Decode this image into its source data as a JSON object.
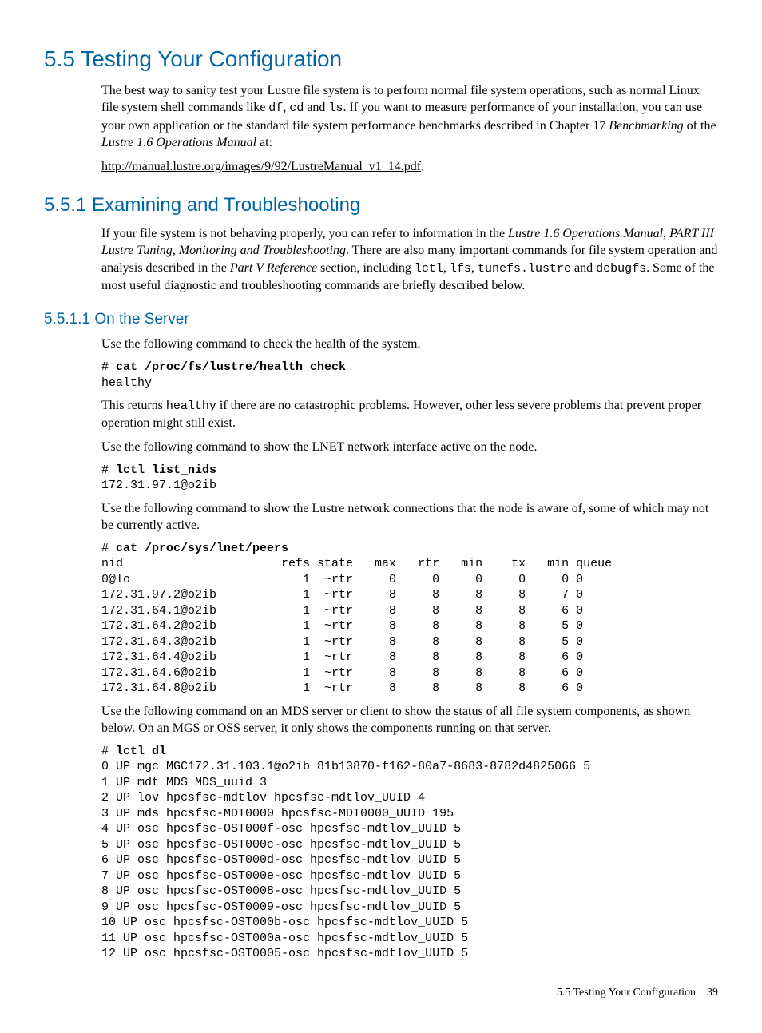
{
  "h1": "5.5 Testing Your Configuration",
  "p1a": "The best way to sanity test your Lustre file system is to perform normal file system operations, such as normal Linux file system shell commands like ",
  "p1b": "df",
  "p1c": ", ",
  "p1d": "cd",
  "p1e": " and ",
  "p1f": "ls",
  "p1g": ". If you want to measure performance of your installation, you can use your own application or the standard file system performance benchmarks described in Chapter 17 ",
  "p1h": "Benchmarking",
  "p1i": " of the ",
  "p1j": "Lustre 1.6 Operations Manual",
  "p1k": " at:",
  "link": "http://manual.lustre.org/images/9/92/LustreManual_v1_14.pdf",
  "p2end": ".",
  "h2": "5.5.1 Examining and Troubleshooting",
  "p3a": "If your file system is not behaving properly, you can refer to information in the ",
  "p3b": "Lustre 1.6 Operations Manual",
  "p3c": ", ",
  "p3d": "PART III Lustre Tuning, Monitoring and Troubleshooting",
  "p3e": ". There are also many important commands for file system operation and analysis described in the ",
  "p3f": "Part V Reference",
  "p3g": " section, including ",
  "p3h": "lctl",
  "p3i": ", ",
  "p3j": "lfs",
  "p3k": ", ",
  "p3l": "tunefs.lustre",
  "p3m": " and ",
  "p3n": "debugfs",
  "p3o": ". Some of the most useful diagnostic and troubleshooting commands are briefly described below.",
  "h3": "5.5.1.1 On the Server",
  "p4": "Use the following command to check the health of the system.",
  "code1_prompt": "# ",
  "code1_cmd": "cat /proc/fs/lustre/health_check",
  "code1_out": "healthy",
  "p5a": "This returns ",
  "p5b": "healthy",
  "p5c": " if there are no catastrophic problems. However, other less severe problems that prevent proper operation might still exist.",
  "p6": "Use the following command to show the LNET network interface active on the node.",
  "code2_prompt": "# ",
  "code2_cmd": "lctl list_nids",
  "code2_out": "172.31.97.1@o2ib",
  "p7": "Use the following command to show the Lustre network connections that the node is aware of, some of which may not be currently active.",
  "code3_prompt": "# ",
  "code3_cmd": "cat /proc/sys/lnet/peers",
  "code3_out": "nid                      refs state   max   rtr   min    tx   min queue\n0@lo                        1  ~rtr     0     0     0     0     0 0\n172.31.97.2@o2ib            1  ~rtr     8     8     8     8     7 0\n172.31.64.1@o2ib            1  ~rtr     8     8     8     8     6 0\n172.31.64.2@o2ib            1  ~rtr     8     8     8     8     5 0\n172.31.64.3@o2ib            1  ~rtr     8     8     8     8     5 0\n172.31.64.4@o2ib            1  ~rtr     8     8     8     8     6 0\n172.31.64.6@o2ib            1  ~rtr     8     8     8     8     6 0\n172.31.64.8@o2ib            1  ~rtr     8     8     8     8     6 0",
  "p8": "Use the following command on an MDS server or client to show the status of all file system components, as shown below. On an MGS or OSS server, it only shows the components running on that server.",
  "code4_prompt": "# ",
  "code4_cmd": "lctl dl",
  "code4_out": "0 UP mgc MGC172.31.103.1@o2ib 81b13870-f162-80a7-8683-8782d4825066 5\n1 UP mdt MDS MDS_uuid 3\n2 UP lov hpcsfsc-mdtlov hpcsfsc-mdtlov_UUID 4\n3 UP mds hpcsfsc-MDT0000 hpcsfsc-MDT0000_UUID 195\n4 UP osc hpcsfsc-OST000f-osc hpcsfsc-mdtlov_UUID 5\n5 UP osc hpcsfsc-OST000c-osc hpcsfsc-mdtlov_UUID 5\n6 UP osc hpcsfsc-OST000d-osc hpcsfsc-mdtlov_UUID 5\n7 UP osc hpcsfsc-OST000e-osc hpcsfsc-mdtlov_UUID 5\n8 UP osc hpcsfsc-OST0008-osc hpcsfsc-mdtlov_UUID 5\n9 UP osc hpcsfsc-OST0009-osc hpcsfsc-mdtlov_UUID 5\n10 UP osc hpcsfsc-OST000b-osc hpcsfsc-mdtlov_UUID 5\n11 UP osc hpcsfsc-OST000a-osc hpcsfsc-mdtlov_UUID 5\n12 UP osc hpcsfsc-OST0005-osc hpcsfsc-mdtlov_UUID 5",
  "footer_text": "5.5 Testing Your Configuration",
  "footer_page": "39"
}
